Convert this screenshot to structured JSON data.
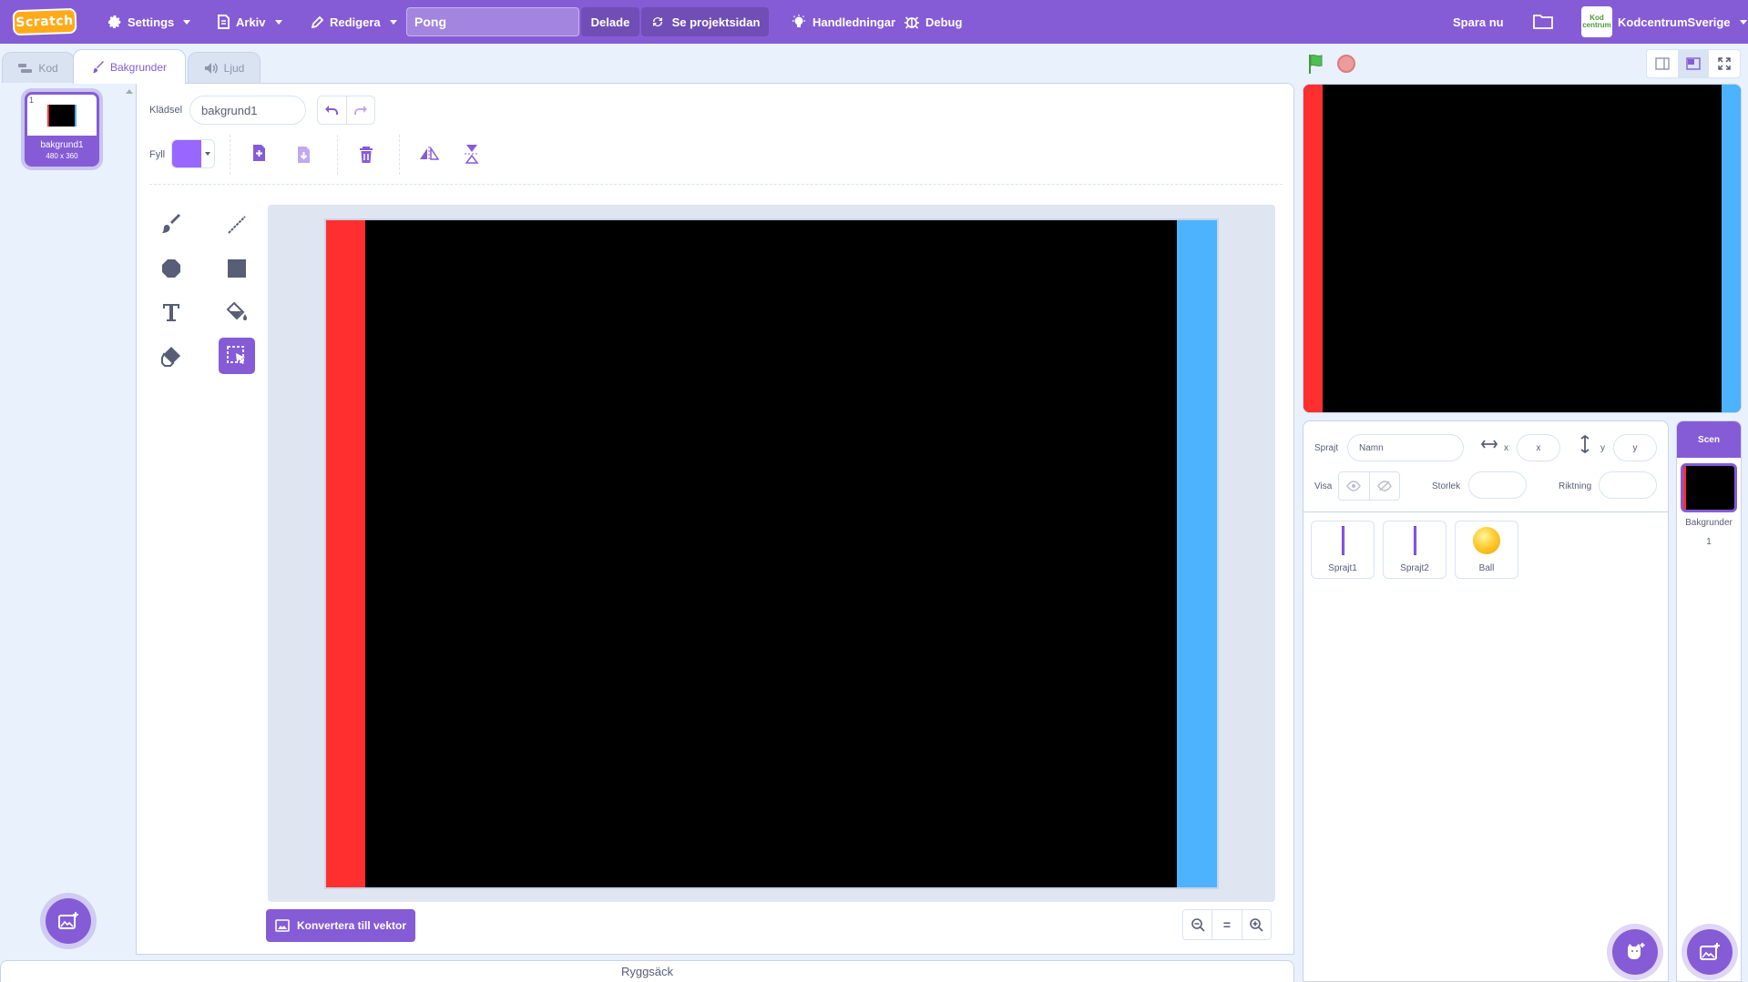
{
  "menubar": {
    "logo_text": "Scratch",
    "settings": "Settings",
    "file": "Arkiv",
    "edit": "Redigera",
    "project_title": "Pong",
    "shared": "Delade",
    "project_page": "Se projektsidan",
    "tutorials": "Handledningar",
    "debug": "Debug",
    "save_now": "Spara nu",
    "username": "KodcentrumSverige",
    "avatar_text": "Kod centrum"
  },
  "tabs": {
    "code": "Kod",
    "backdrops": "Bakgrunder",
    "sounds": "Ljud"
  },
  "costumes": [
    {
      "number": "1",
      "name": "bakgrund1",
      "size": "480 x 360"
    }
  ],
  "paint_editor": {
    "costume_label": "Klädsel",
    "costume_name": "bakgrund1",
    "fill_label": "Fyll",
    "fill_color": "#9966ff",
    "convert_button": "Konvertera till vektor",
    "zoom_reset": "="
  },
  "backpack": "Ryggsäck",
  "sprite_info": {
    "sprite_label": "Sprajt",
    "name_placeholder": "Namn",
    "x_label": "x",
    "x_placeholder": "x",
    "y_label": "y",
    "y_placeholder": "y",
    "show_label": "Visa",
    "size_label": "Storlek",
    "direction_label": "Riktning"
  },
  "sprites": [
    {
      "name": "Sprajt1",
      "icon": "paddle"
    },
    {
      "name": "Sprajt2",
      "icon": "paddle"
    },
    {
      "name": "Ball",
      "icon": "ball"
    }
  ],
  "stage_selector": {
    "header": "Scen",
    "backdrops_label": "Bakgrunder",
    "backdrops_count": "1"
  },
  "colors": {
    "accent": "#855cd6",
    "left_wall": "#ff2f2f",
    "right_wall": "#4db3ff",
    "background": "#000000"
  }
}
